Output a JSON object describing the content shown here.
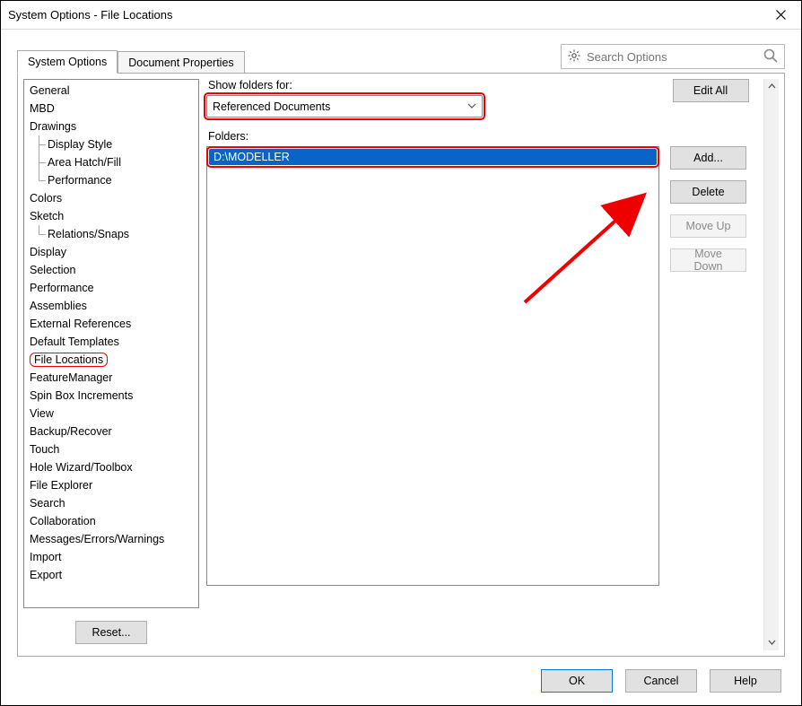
{
  "window": {
    "title": "System Options - File Locations"
  },
  "tabs": {
    "system_options": "System Options",
    "document_properties": "Document Properties"
  },
  "search": {
    "placeholder": "Search Options"
  },
  "nav": {
    "items": [
      {
        "label": "General",
        "level": 1
      },
      {
        "label": "MBD",
        "level": 1
      },
      {
        "label": "Drawings",
        "level": 1
      },
      {
        "label": "Display Style",
        "level": 2,
        "cont": true
      },
      {
        "label": "Area Hatch/Fill",
        "level": 2,
        "cont": true
      },
      {
        "label": "Performance",
        "level": 2
      },
      {
        "label": "Colors",
        "level": 1
      },
      {
        "label": "Sketch",
        "level": 1
      },
      {
        "label": "Relations/Snaps",
        "level": 2
      },
      {
        "label": "Display",
        "level": 1
      },
      {
        "label": "Selection",
        "level": 1
      },
      {
        "label": "Performance",
        "level": 1
      },
      {
        "label": "Assemblies",
        "level": 1
      },
      {
        "label": "External References",
        "level": 1
      },
      {
        "label": "Default Templates",
        "level": 1
      },
      {
        "label": "File Locations",
        "level": 1,
        "highlight": true
      },
      {
        "label": "FeatureManager",
        "level": 1
      },
      {
        "label": "Spin Box Increments",
        "level": 1
      },
      {
        "label": "View",
        "level": 1
      },
      {
        "label": "Backup/Recover",
        "level": 1
      },
      {
        "label": "Touch",
        "level": 1
      },
      {
        "label": "Hole Wizard/Toolbox",
        "level": 1
      },
      {
        "label": "File Explorer",
        "level": 1
      },
      {
        "label": "Search",
        "level": 1
      },
      {
        "label": "Collaboration",
        "level": 1
      },
      {
        "label": "Messages/Errors/Warnings",
        "level": 1
      },
      {
        "label": "Import",
        "level": 1
      },
      {
        "label": "Export",
        "level": 1
      }
    ],
    "reset": "Reset..."
  },
  "content": {
    "show_folders_label": "Show folders for:",
    "dropdown_value": "Referenced Documents",
    "folders_label": "Folders:",
    "folder_items": [
      "D:\\MODELLER"
    ],
    "edit_all": "Edit All",
    "add": "Add...",
    "delete": "Delete",
    "move_up": "Move Up",
    "move_down": "Move Down"
  },
  "buttons": {
    "ok": "OK",
    "cancel": "Cancel",
    "help": "Help"
  }
}
